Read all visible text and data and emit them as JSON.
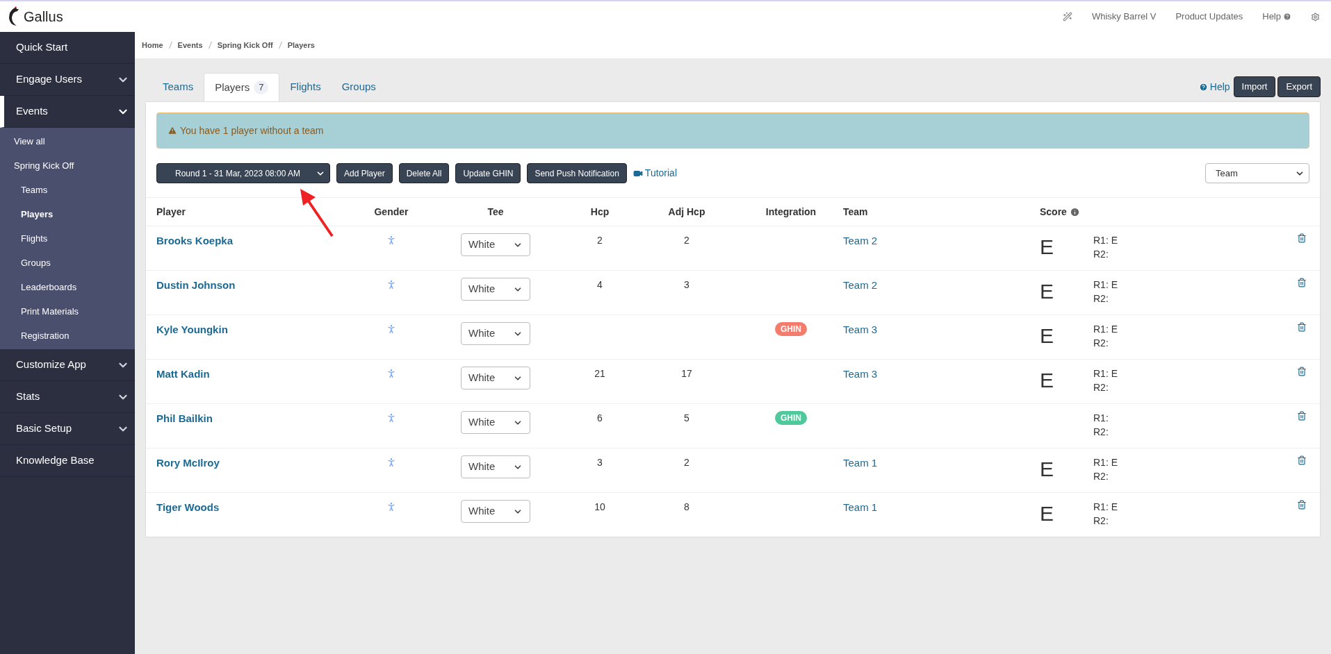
{
  "header": {
    "brand": "Gallus",
    "links": [
      "Whisky Barrel V",
      "Product Updates",
      "Help"
    ]
  },
  "sidebar": {
    "items": [
      {
        "label": "Quick Start",
        "selected": false,
        "kind": "link"
      },
      {
        "label": "Engage Users",
        "selected": false,
        "kind": "group",
        "expanded": false
      },
      {
        "label": "Events",
        "selected": true,
        "kind": "group",
        "expanded": true,
        "children": [
          {
            "label": "View all",
            "selected": false
          },
          {
            "label": "Spring Kick Off",
            "selected": false,
            "children": [
              {
                "label": "Teams",
                "selected": false
              },
              {
                "label": "Players",
                "selected": true
              },
              {
                "label": "Flights",
                "selected": false
              },
              {
                "label": "Groups",
                "selected": false
              },
              {
                "label": "Leaderboards",
                "selected": false
              },
              {
                "label": "Print Materials",
                "selected": false
              },
              {
                "label": "Registration",
                "selected": false
              }
            ]
          }
        ]
      },
      {
        "label": "Customize App",
        "selected": false,
        "kind": "group",
        "expanded": false
      },
      {
        "label": "Stats",
        "selected": false,
        "kind": "group",
        "expanded": false
      },
      {
        "label": "Basic Setup",
        "selected": false,
        "kind": "group",
        "expanded": false
      },
      {
        "label": "Knowledge Base",
        "selected": false,
        "kind": "link"
      }
    ]
  },
  "breadcrumb": [
    "Home",
    "Events",
    "Spring Kick Off",
    "Players"
  ],
  "tabs": [
    {
      "label": "Teams",
      "selected": false
    },
    {
      "label": "Players",
      "count": "7",
      "selected": true
    },
    {
      "label": "Flights",
      "selected": false
    },
    {
      "label": "Groups",
      "selected": false
    }
  ],
  "top_actions": {
    "help": "Help",
    "buttons": [
      "Import",
      "Export"
    ]
  },
  "alert": "You have 1 player without a team",
  "toolbar": {
    "round_select": "Round 1 - 31 Mar, 2023 08:00 AM",
    "buttons": [
      "Add Player",
      "Delete All",
      "Update GHIN",
      "Send Push Notification"
    ],
    "tutorial": "Tutorial",
    "group_by": "Team"
  },
  "table": {
    "columns": [
      "Player",
      "Gender",
      "Tee",
      "Hcp",
      "Adj Hcp",
      "Integration",
      "Team",
      "Score"
    ],
    "rows": [
      {
        "player": "Brooks Koepka",
        "tee": "White",
        "hcp": "2",
        "adj_hcp": "2",
        "team": "Team 2",
        "score": "E",
        "rounds": [
          "R1: E",
          "R2:"
        ]
      },
      {
        "player": "Dustin Johnson",
        "tee": "White",
        "hcp": "4",
        "adj_hcp": "3",
        "team": "Team 2",
        "score": "E",
        "rounds": [
          "R1: E",
          "R2:"
        ]
      },
      {
        "player": "Kyle Youngkin",
        "tee": "White",
        "integration": {
          "label": "GHIN",
          "color": "#f47c6c"
        },
        "team": "Team 3",
        "score": "E",
        "rounds": [
          "R1: E",
          "R2:"
        ]
      },
      {
        "player": "Matt Kadin",
        "tee": "White",
        "hcp": "21",
        "adj_hcp": "17",
        "team": "Team 3",
        "score": "E",
        "rounds": [
          "R1: E",
          "R2:"
        ]
      },
      {
        "player": "Phil Bailkin",
        "tee": "White",
        "hcp": "6",
        "adj_hcp": "5",
        "integration": {
          "label": "GHIN",
          "color": "#4fc99b"
        },
        "rounds": [
          "R1:",
          "R2:"
        ]
      },
      {
        "player": "Rory McIlroy",
        "tee": "White",
        "hcp": "3",
        "adj_hcp": "2",
        "team": "Team 1",
        "score": "E",
        "rounds": [
          "R1: E",
          "R2:"
        ]
      },
      {
        "player": "Tiger Woods",
        "tee": "White",
        "hcp": "10",
        "adj_hcp": "8",
        "team": "Team 1",
        "score": "E",
        "rounds": [
          "R1: E",
          "R2:"
        ]
      }
    ]
  }
}
